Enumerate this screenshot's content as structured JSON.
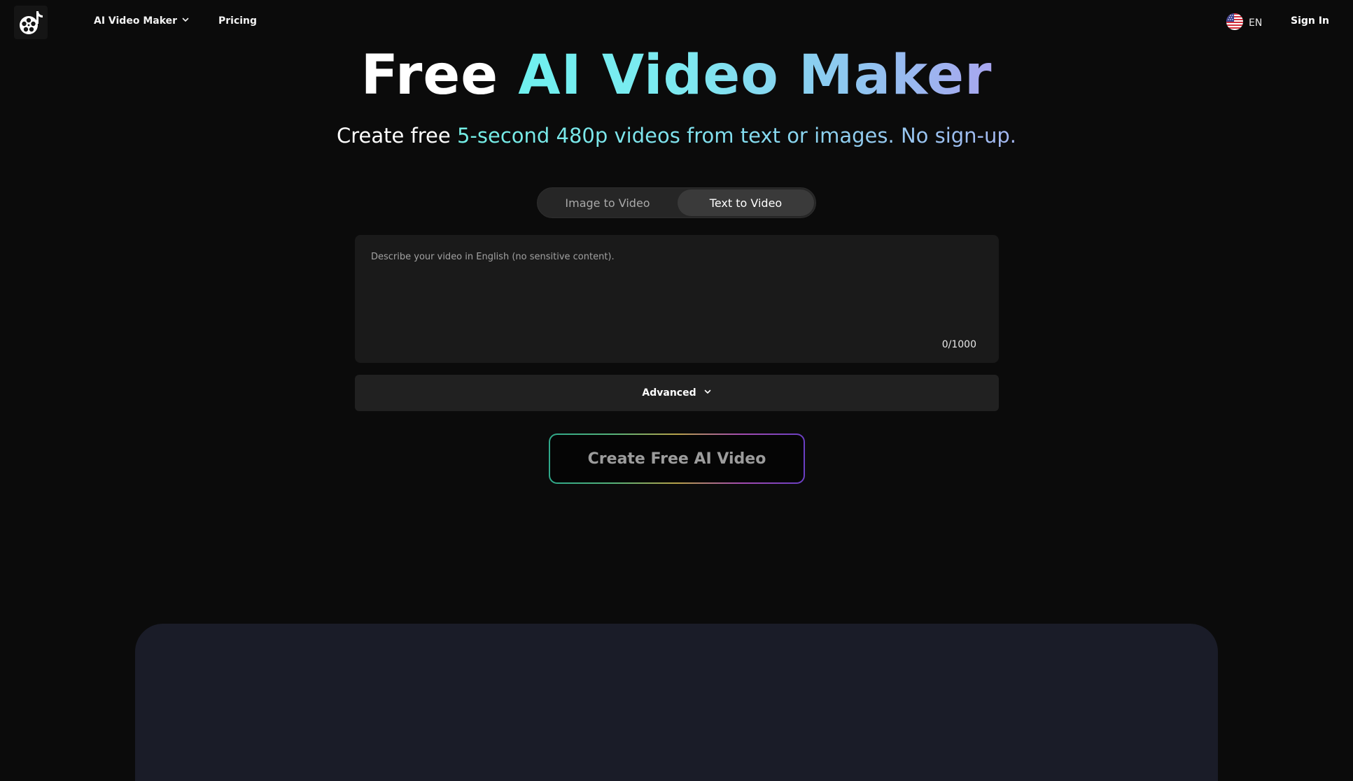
{
  "nav": {
    "menu_label": "AI Video Maker",
    "pricing_label": "Pricing",
    "language": "EN",
    "sign_in_label": "Sign In"
  },
  "hero": {
    "title_word1": "Free",
    "title_word2": "AI Video Maker",
    "subtitle_part1": "Create free",
    "subtitle_part2": "5-second 480p videos from text or images. No sign-up."
  },
  "tabs": [
    {
      "label": "Image to Video",
      "active": false
    },
    {
      "label": "Text to Video",
      "active": true
    }
  ],
  "prompt": {
    "value": "",
    "placeholder": "Describe your video in English (no sensitive content).",
    "counter": "0/1000"
  },
  "advanced": {
    "label": "Advanced"
  },
  "create_button": {
    "label": "Create Free AI Video"
  },
  "colors": {
    "background": "#0b0b0b",
    "gradient_start": "#6ff0ef",
    "gradient_end": "#a8a6ef",
    "preview_panel": "#1a1c28"
  },
  "icons": {
    "logo": "film-reel-music-note-icon",
    "menu_chevron": "chevron-down-icon",
    "language_flag": "us-flag-icon",
    "advanced_chevron": "chevron-down-icon"
  }
}
